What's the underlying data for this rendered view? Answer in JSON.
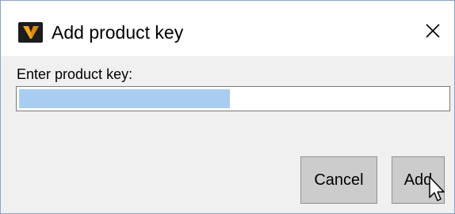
{
  "window": {
    "title": "Add product key",
    "app_icon": "vectorworks-v-logo",
    "close_icon": "close-icon",
    "accent_color": "#f5a623"
  },
  "form": {
    "prompt_label": "Enter product key:",
    "product_key_value": "",
    "selection_fill_color": "#a8cdf0"
  },
  "buttons": {
    "cancel_label": "Cancel",
    "add_label": "Add"
  },
  "cursor": {
    "icon": "arrow-pointer-icon"
  }
}
